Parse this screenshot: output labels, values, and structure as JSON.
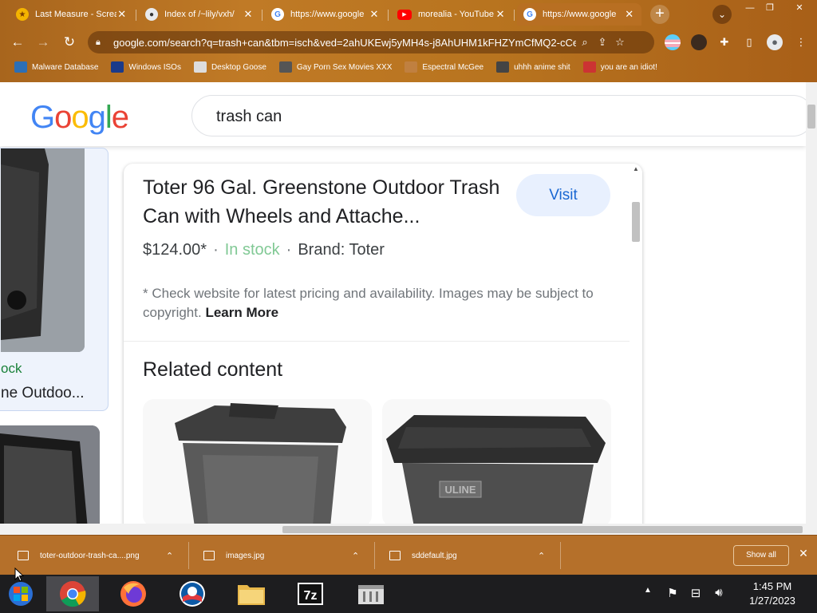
{
  "tabs": [
    {
      "label": "Last Measure - Screa",
      "favicon": "star-icon",
      "color": "#f4b400"
    },
    {
      "label": "Index of /~lily/vxh/",
      "favicon": "site-icon",
      "color": "#9aa0a6"
    },
    {
      "label": "https://www.google",
      "favicon": "google-icon",
      "color": "#4285f4"
    },
    {
      "label": "morealia - YouTube",
      "favicon": "youtube-icon",
      "color": "#ff0000"
    },
    {
      "label": "https://www.google",
      "favicon": "google-icon",
      "color": "#4285f4"
    }
  ],
  "address_bar": {
    "url": "google.com/search?q=trash+can&tbm=isch&ved=2ahUKEwj5yMH4s-j8AhUHM1kFHZYmCfMQ2-cCe..."
  },
  "bookmarks": [
    {
      "label": "Malware Database",
      "color": "#2d6fb5"
    },
    {
      "label": "Windows ISOs",
      "color": "#1a3a8a"
    },
    {
      "label": "Desktop Goose",
      "color": "#dddddd"
    },
    {
      "label": "Gay Porn Sex Movies XXX",
      "color": "#555555"
    },
    {
      "label": "Espectral McGee",
      "color": "#c08040"
    },
    {
      "label": "uhhh anime shit",
      "color": "#444444"
    },
    {
      "label": "you are an idiot!",
      "color": "#cc3333"
    }
  ],
  "search": {
    "logo": [
      "G",
      "o",
      "o",
      "g",
      "l",
      "e"
    ],
    "logo_colors": [
      "#4285f4",
      "#ea4335",
      "#fbbc05",
      "#4285f4",
      "#34a853",
      "#ea4335"
    ],
    "query": "trash can"
  },
  "left_result": {
    "stock": "ock",
    "name": "ne Outdoo..."
  },
  "product": {
    "title": "Toter 96 Gal. Greenstone Outdoor Trash Can with Wheels and Attache...",
    "visit_label": "Visit",
    "price": "$124.00*",
    "stock": "In stock",
    "brand": "Brand: Toter",
    "note": "* Check website for latest pricing and availability. Images may be subject to copyright.",
    "learn_more": "Learn More",
    "related_heading": "Related content",
    "related_logo_text": "ULINE"
  },
  "downloads": [
    {
      "name": "toter-outdoor-trash-ca....png"
    },
    {
      "name": "images.jpg"
    },
    {
      "name": "sddefault.jpg"
    }
  ],
  "download_bar": {
    "show_all": "Show all"
  },
  "taskbar": {
    "time": "1:45 PM",
    "date": "1/27/2023"
  }
}
